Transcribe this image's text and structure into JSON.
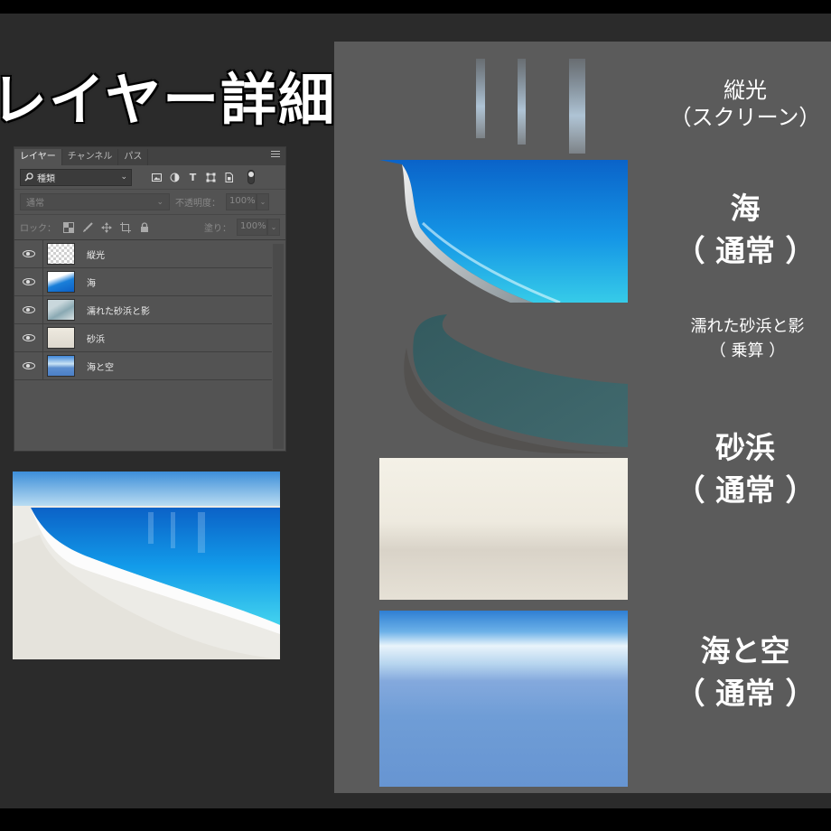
{
  "title": "レイヤー詳細",
  "panel": {
    "tabs": [
      "レイヤー",
      "チャンネル",
      "パス"
    ],
    "filter": {
      "label": "種類",
      "icon": "search-icon"
    },
    "blend_mode": "通常",
    "opacity": {
      "label": "不透明度：",
      "value": "100%"
    },
    "lock_label": "ロック：",
    "fill": {
      "label": "塗り：",
      "value": "100%"
    },
    "layers": [
      {
        "name": "縦光",
        "thumb": "transparent"
      },
      {
        "name": "海",
        "thumb": "sea"
      },
      {
        "name": "濡れた砂浜と影",
        "thumb": "wet-sand"
      },
      {
        "name": "砂浜",
        "thumb": "sand"
      },
      {
        "name": "海と空",
        "thumb": "sea-sky"
      }
    ]
  },
  "captions": [
    {
      "line1": "縦光",
      "line2": "（スクリーン）"
    },
    {
      "line1": "海",
      "line2": "（ 通常 ）"
    },
    {
      "line1": "濡れた砂浜と影",
      "line2": "（ 乗算 ）"
    },
    {
      "line1": "砂浜",
      "line2": "（ 通常 ）"
    },
    {
      "line1": "海と空",
      "line2": "（ 通常 ）"
    }
  ],
  "colors": {
    "panel_bg": "#535353",
    "canvas_bg": "#2b2b2b",
    "right_bg": "#5b5b5b",
    "sea_blue": "#1a8fe0",
    "sky_blue": "#6a9ad6"
  }
}
